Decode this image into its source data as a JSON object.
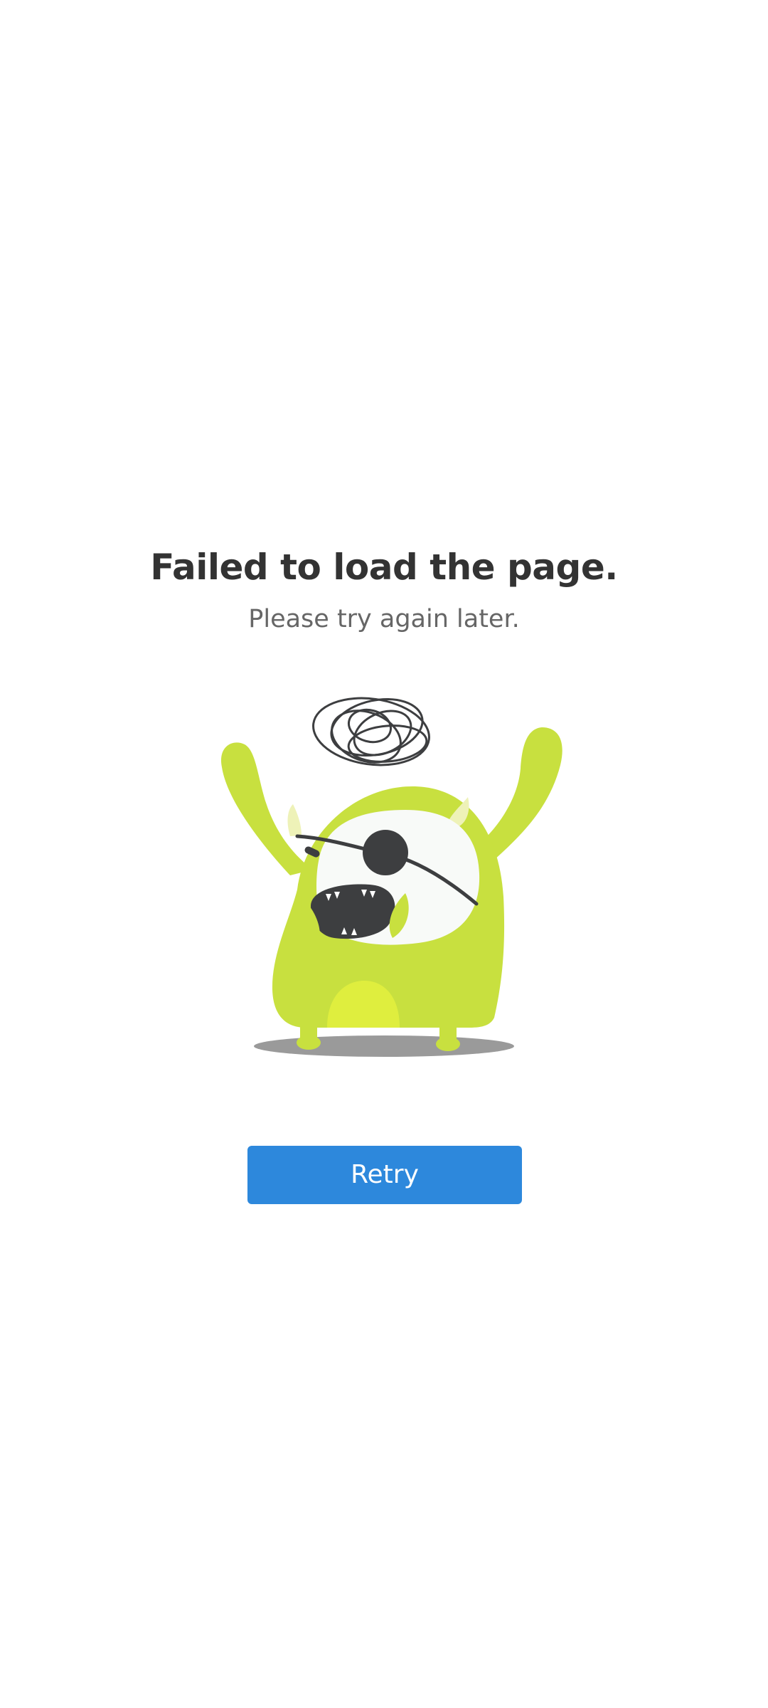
{
  "error": {
    "title": "Failed to load the page.",
    "subtitle": "Please try again later."
  },
  "illustration": {
    "icon": "angry-one-eyed-monster-icon",
    "colors": {
      "body": "#c8e03f",
      "belly": "#dfee3e",
      "face": "#f8faf8",
      "dark": "#3d3e40",
      "shadow": "#9a9a9a",
      "horn": "#eef2b8"
    }
  },
  "actions": {
    "retry_label": "Retry",
    "retry_color": "#2d88dc"
  }
}
